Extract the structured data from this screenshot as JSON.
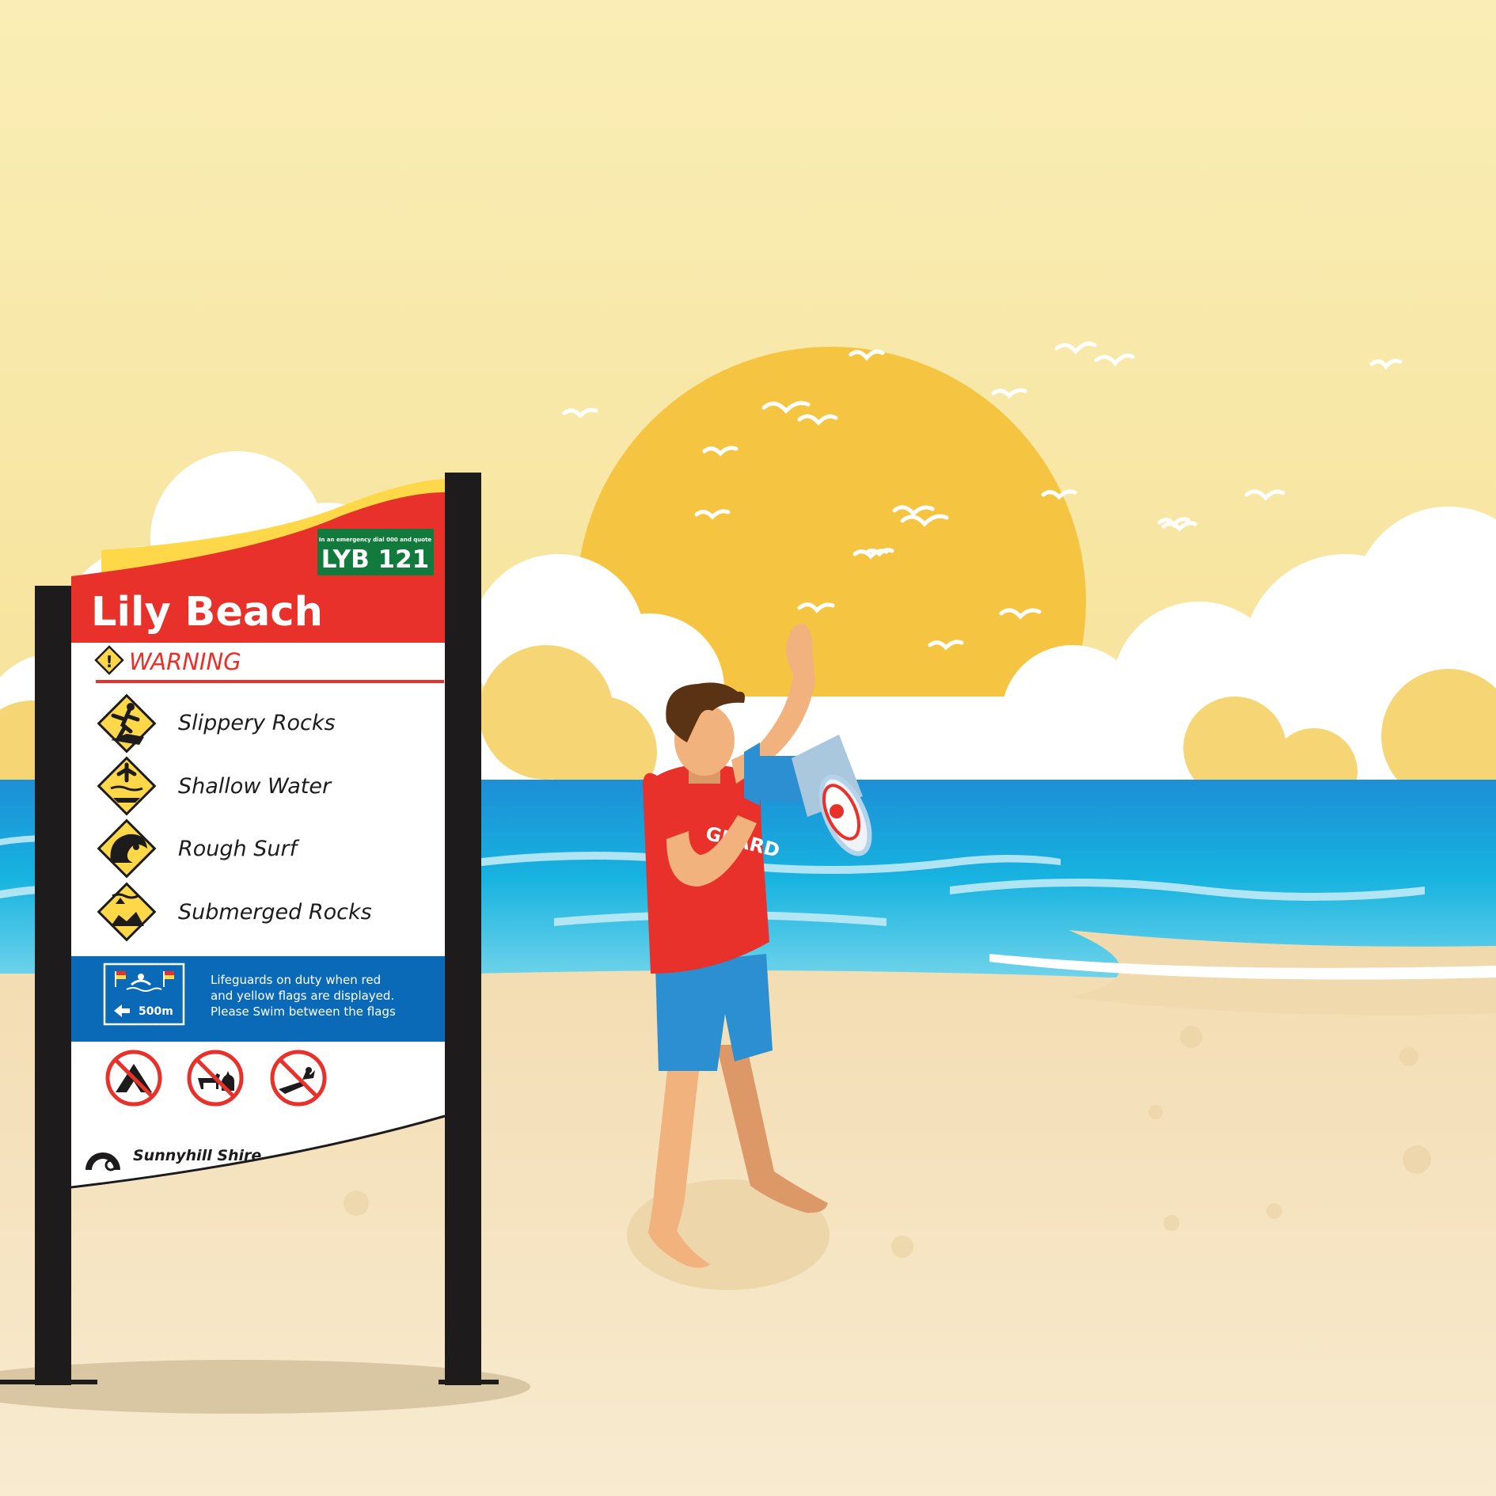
{
  "sign": {
    "beach_name": "Lily Beach",
    "emergency_note": "In an emergency dial 000 and quote",
    "location_code": "LYB 121",
    "warning_heading": "WARNING",
    "hazards": [
      {
        "label": "Slippery Rocks",
        "icon": "slippery-rocks-icon"
      },
      {
        "label": "Shallow Water",
        "icon": "shallow-water-icon"
      },
      {
        "label": "Rough Surf",
        "icon": "rough-surf-icon"
      },
      {
        "label": "Submerged Rocks",
        "icon": "submerged-rocks-icon"
      }
    ],
    "lifeguard": {
      "distance": "500m",
      "line1": "Lifeguards on duty when red",
      "line2": "and yellow flags are displayed.",
      "line3": "Please Swim between the flags"
    },
    "prohibitions": [
      "no-camping-icon",
      "no-dogs-or-cats-icon",
      "no-fires-icon"
    ],
    "council": "Sunnyhill Shire"
  },
  "lifeguard_shirt_text": "GUARD",
  "colors": {
    "sky": "#f9ebab",
    "sun": "#f5c542",
    "sea": "#1aa3d9",
    "sand": "#f5e6c4",
    "sign_red": "#e8312a",
    "sign_blue": "#0b6ab8",
    "sign_yellow": "#ffd84a",
    "code_green": "#137a3e"
  }
}
